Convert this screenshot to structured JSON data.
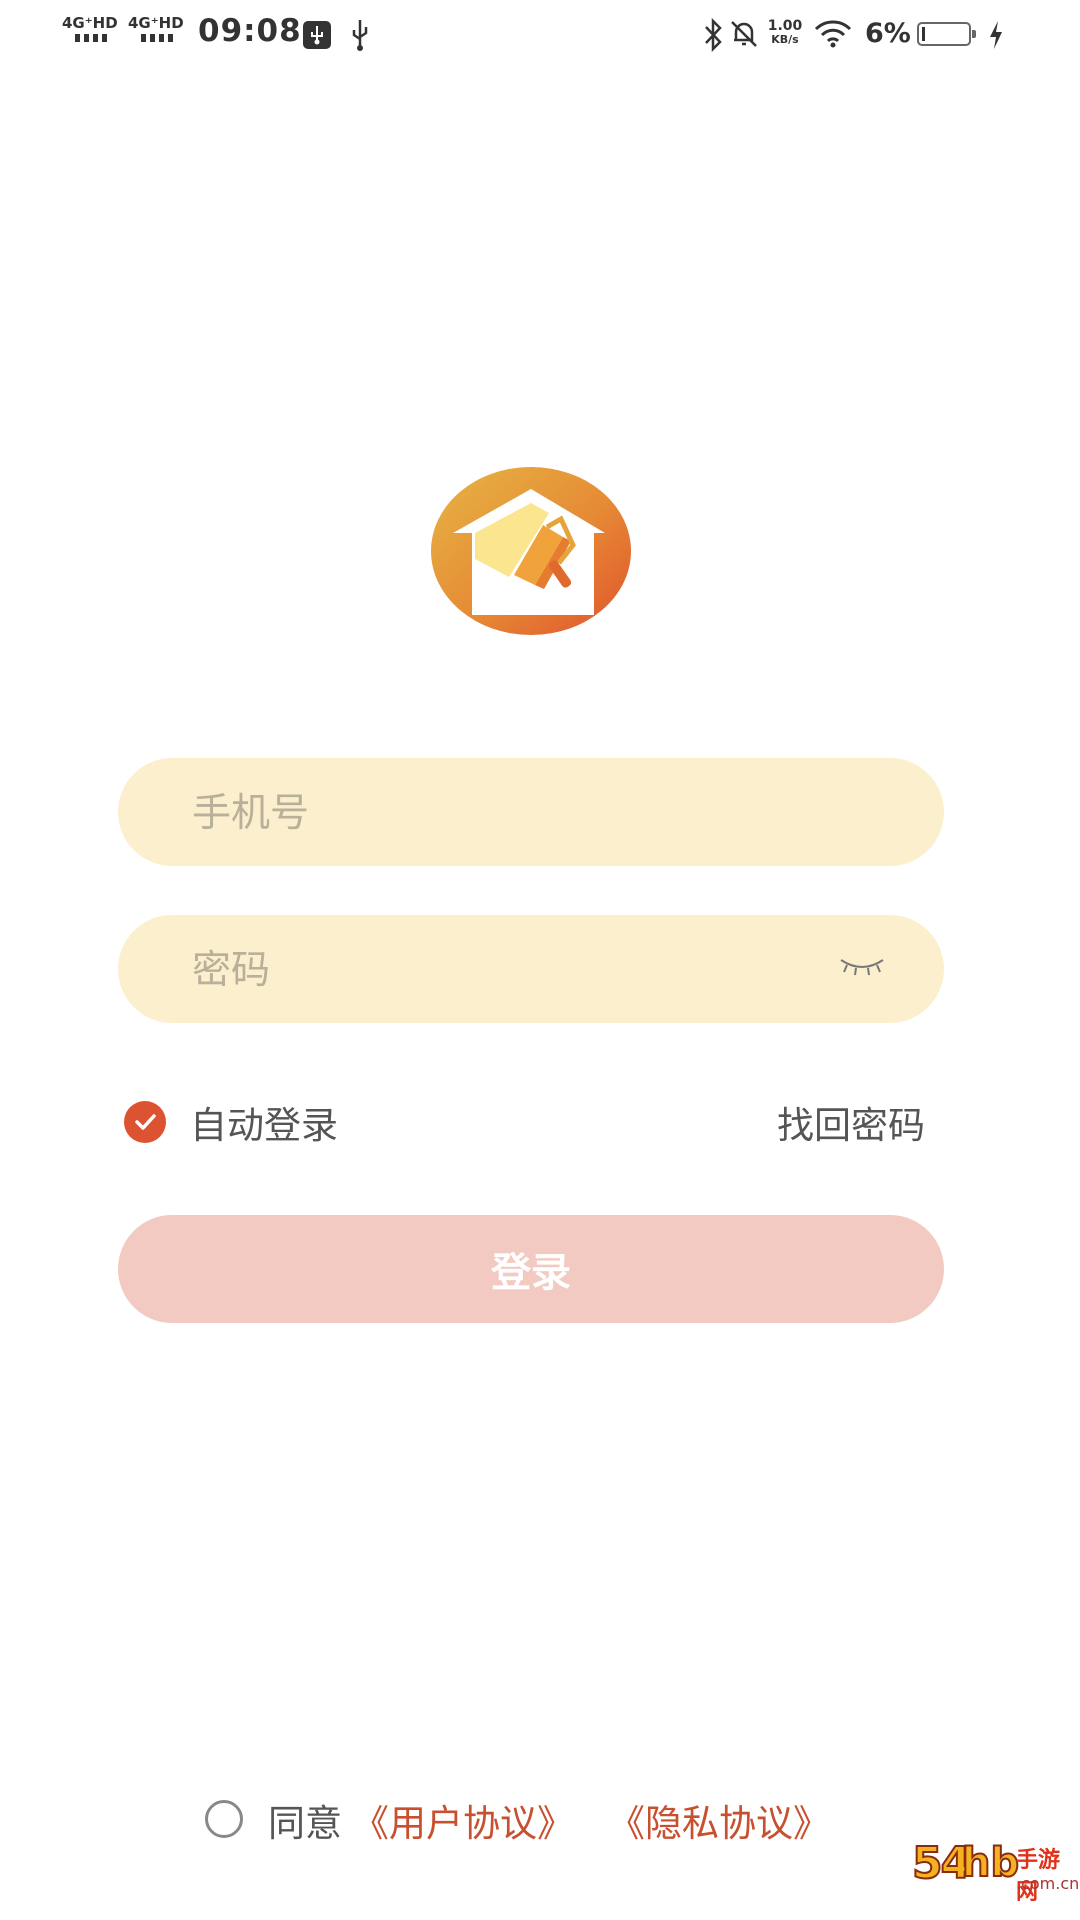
{
  "status_bar": {
    "sim1": "4G⁺HD",
    "sim2": "4G⁺HD",
    "time": "09:08",
    "speed_value": "1.00",
    "speed_unit": "KB/s",
    "battery": "6%",
    "battery_level": 0.06
  },
  "login": {
    "phone_placeholder": "手机号",
    "password_placeholder": "密码",
    "auto_login_label": "自动登录",
    "auto_login_checked": true,
    "forgot_password": "找回密码",
    "login_button": "登录"
  },
  "agreement": {
    "agree_label": "同意",
    "user_agreement": "《用户协议》",
    "privacy_agreement": "《隐私协议》"
  },
  "colors": {
    "accent": "#dd5230",
    "input_bg": "#fbefce",
    "button_bg": "#f2cac1",
    "link": "#c8502f"
  },
  "watermark": {
    "text": "54hb手游网 .com.cn"
  }
}
